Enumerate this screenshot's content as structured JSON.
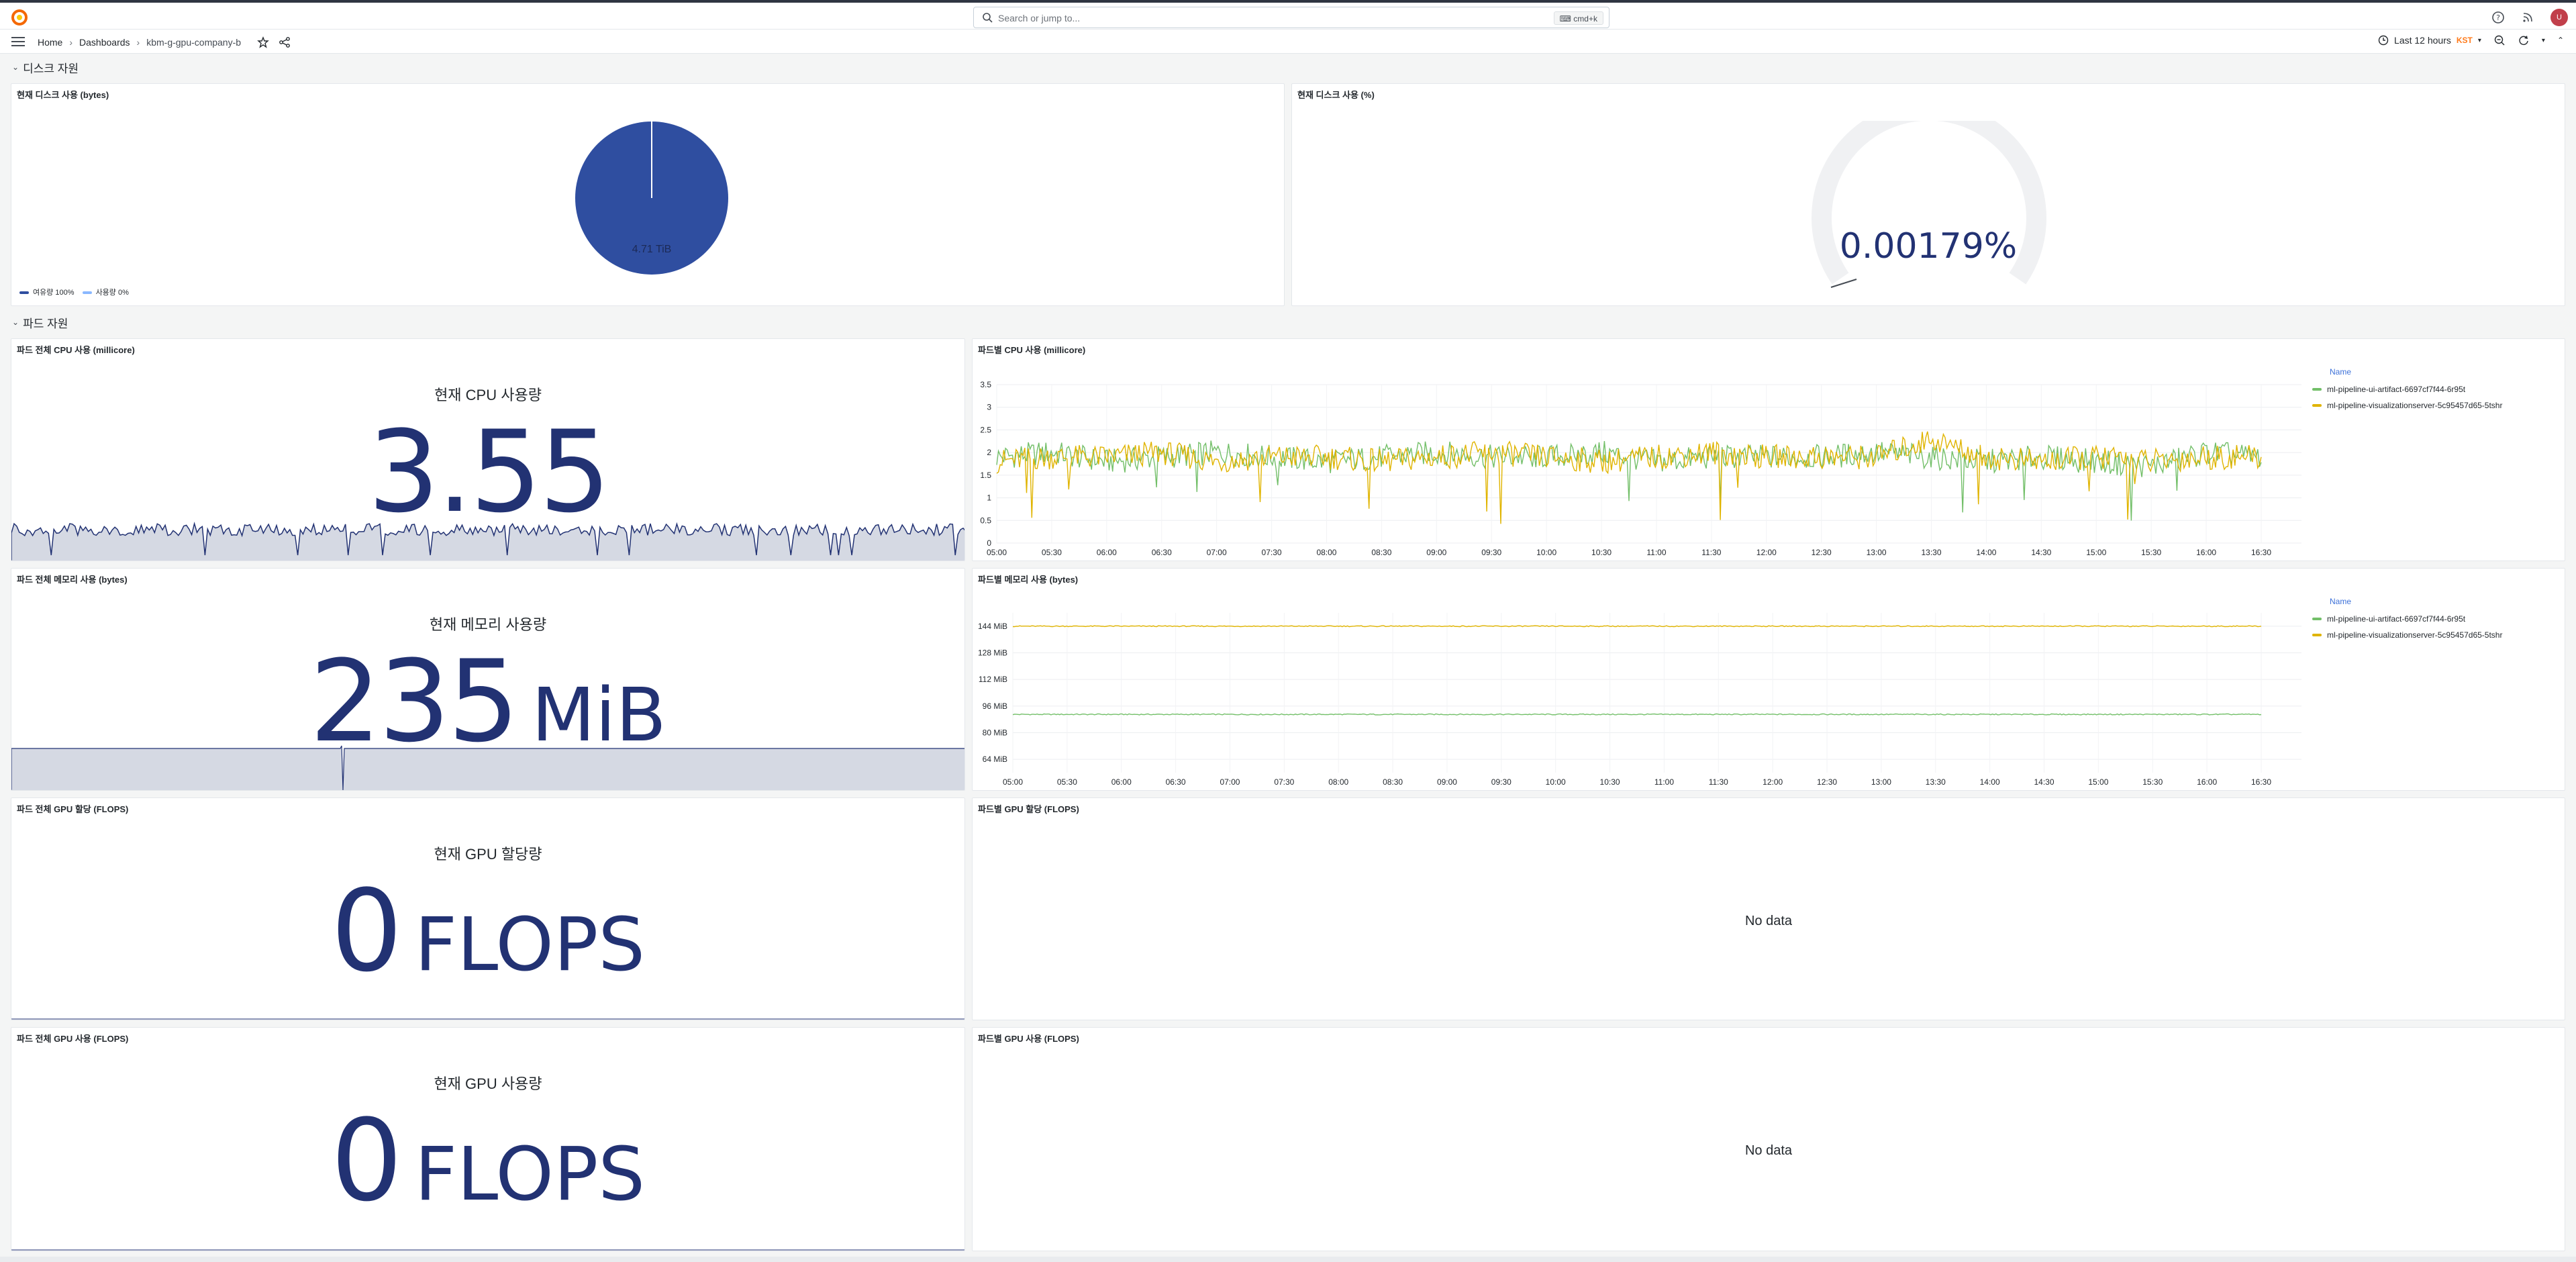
{
  "search": {
    "placeholder": "Search or jump to...",
    "shortcut": "⌨ cmd+k"
  },
  "breadcrumb": {
    "home": "Home",
    "dashboards": "Dashboards",
    "current": "kbm-g-gpu-company-b"
  },
  "time_picker": {
    "label": "Last 12 hours",
    "tz": "KST"
  },
  "rows": {
    "disk": "디스크 자원",
    "pod": "파드 자원"
  },
  "panels": {
    "disk_bytes": {
      "title": "현재 디스크 사용 (bytes)",
      "pie_label": "4.71 TiB",
      "legend": [
        "여유량 100%",
        "사용량 0%"
      ]
    },
    "disk_pct": {
      "title": "현재 디스크 사용 (%)",
      "value": "0.00179%"
    },
    "cpu_total": {
      "title": "파드 전체 CPU 사용 (millicore)",
      "label": "현재 CPU 사용량",
      "value": "3.55"
    },
    "cpu_by_pod": {
      "title": "파드별 CPU 사용 (millicore)"
    },
    "mem_total": {
      "title": "파드 전체 메모리 사용 (bytes)",
      "label": "현재 메모리 사용량",
      "value": "235",
      "unit": "MiB"
    },
    "mem_by_pod": {
      "title": "파드별 메모리 사용 (bytes)"
    },
    "gpu_alloc_total": {
      "title": "파드 전체 GPU 할당 (FLOPS)",
      "label": "현재 GPU 할당량",
      "value": "0",
      "unit": "FLOPS"
    },
    "gpu_alloc_by_pod": {
      "title": "파드별 GPU 할당 (FLOPS)",
      "nodata": "No data"
    },
    "gpu_use_total": {
      "title": "파드 전체 GPU 사용 (FLOPS)",
      "label": "현재 GPU 사용량",
      "value": "0",
      "unit": "FLOPS"
    },
    "gpu_use_by_pod": {
      "title": "파드별 GPU 사용 (FLOPS)",
      "nodata": "No data"
    }
  },
  "legend": {
    "header": "Name",
    "series": [
      "ml-pipeline-ui-artifact-6697cf7f44-6r95t",
      "ml-pipeline-visualizationserver-5c95457d65-5tshr"
    ]
  },
  "colors": {
    "series1": "#73bf69",
    "series2": "#e0b400",
    "stat": "#223273",
    "pie": "#2f4ea0"
  },
  "chart_data": [
    {
      "type": "line",
      "title": "파드별 CPU 사용 (millicore)",
      "x": [
        "05:00",
        "05:30",
        "06:00",
        "06:30",
        "07:00",
        "07:30",
        "08:00",
        "08:30",
        "09:00",
        "09:30",
        "10:00",
        "10:30",
        "11:00",
        "11:30",
        "12:00",
        "12:30",
        "13:00",
        "13:30",
        "14:00",
        "14:30",
        "15:00",
        "15:30",
        "16:00",
        "16:30"
      ],
      "y_ticks": [
        "0",
        "0.5",
        "1",
        "1.5",
        "2",
        "2.5",
        "3",
        "3.5"
      ],
      "ylim": [
        0,
        3.5
      ],
      "series": [
        {
          "name": "ml-pipeline-ui-artifact-6697cf7f44-6r95t",
          "values": [
            1.9,
            2.0,
            1.8,
            1.9,
            2.0,
            1.9,
            1.8,
            1.9,
            2.0,
            1.9,
            1.9,
            2.0,
            1.8,
            1.9,
            1.9,
            1.9,
            2.0,
            1.9,
            1.8,
            1.9,
            1.8,
            1.7,
            2.0,
            1.9
          ]
        },
        {
          "name": "ml-pipeline-visualizationserver-5c95457d65-5tshr",
          "values": [
            1.8,
            1.9,
            1.9,
            2.0,
            1.8,
            1.9,
            1.9,
            1.8,
            1.9,
            2.0,
            1.9,
            1.8,
            1.9,
            2.0,
            1.9,
            1.9,
            1.9,
            2.3,
            1.9,
            1.8,
            1.9,
            1.8,
            1.9,
            1.9
          ]
        }
      ]
    },
    {
      "type": "line",
      "title": "파드별 메모리 사용 (bytes)",
      "x": [
        "05:00",
        "05:30",
        "06:00",
        "06:30",
        "07:00",
        "07:30",
        "08:00",
        "08:30",
        "09:00",
        "09:30",
        "10:00",
        "10:30",
        "11:00",
        "11:30",
        "12:00",
        "12:30",
        "13:00",
        "13:30",
        "14:00",
        "14:30",
        "15:00",
        "15:30",
        "16:00",
        "16:30"
      ],
      "y_ticks": [
        "64 MiB",
        "80 MiB",
        "96 MiB",
        "112 MiB",
        "128 MiB",
        "144 MiB"
      ],
      "ylim": [
        56,
        152
      ],
      "series": [
        {
          "name": "ml-pipeline-ui-artifact-6697cf7f44-6r95t",
          "values": [
            91,
            91,
            91,
            91,
            91,
            91,
            91,
            91,
            91,
            91,
            91,
            91,
            91,
            91,
            91,
            91,
            91,
            91,
            91,
            91,
            91,
            91,
            91,
            91
          ]
        },
        {
          "name": "ml-pipeline-visualizationserver-5c95457d65-5tshr",
          "values": [
            144,
            144,
            144,
            144,
            144,
            144,
            144,
            144,
            144,
            144,
            144,
            144,
            144,
            144,
            144,
            144,
            144,
            144,
            144,
            144,
            144,
            144,
            144,
            144
          ]
        }
      ]
    }
  ]
}
